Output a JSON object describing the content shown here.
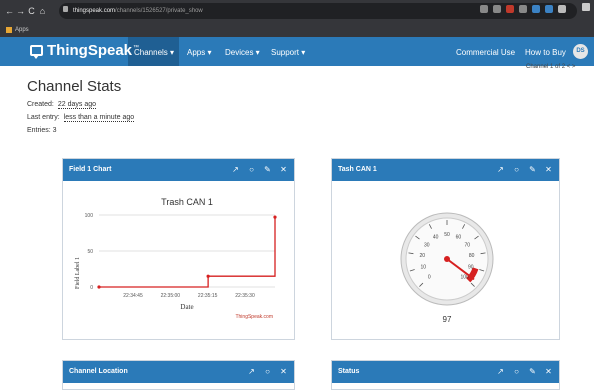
{
  "browser": {
    "url_host": "thingspeak.com",
    "url_path": "/channels/1526527/private_show",
    "bookmark_apps": "Apps"
  },
  "nav": {
    "logo": "ThingSpeak",
    "logo_tm": "™",
    "items": [
      "Channels ▾",
      "Apps ▾",
      "Devices ▾",
      "Support ▾"
    ],
    "right_items": [
      "Commercial Use",
      "How to Buy"
    ],
    "avatar": "DS"
  },
  "page": {
    "title": "Channel Stats",
    "channel_of": "Channel 1 of 2  <  >",
    "created_label": "Created:",
    "created_value": "22 days ago",
    "last_entry_label": "Last entry:",
    "last_entry_value": "less than a minute ago",
    "entries": "Entries: 3"
  },
  "panels": [
    {
      "title": "Field 1 Chart"
    },
    {
      "title": "Tash CAN 1"
    },
    {
      "title": "Channel Location"
    },
    {
      "title": "Status"
    }
  ],
  "chart_data": {
    "type": "line",
    "title": "Trash CAN 1",
    "xlabel": "Date",
    "ylabel": "Field Label 1",
    "x_ticks": [
      "22:34:45",
      "22:35:00",
      "22:35:15",
      "22:35:30"
    ],
    "y_ticks": [
      "0",
      "50",
      "100"
    ],
    "ylim": [
      0,
      100
    ],
    "x": [
      0,
      0.62,
      0.62,
      1.0,
      1.0
    ],
    "y": [
      0,
      0,
      15,
      15,
      97
    ],
    "credit": "ThingSpeak.com",
    "line_color": "#d62020"
  },
  "gauge": {
    "value": "97",
    "ticks": [
      "0",
      "10",
      "20",
      "30",
      "40",
      "50",
      "60",
      "70",
      "80",
      "90",
      "100"
    ],
    "min": 0,
    "max": 100,
    "reading": 97,
    "danger_color": "#d62020"
  }
}
